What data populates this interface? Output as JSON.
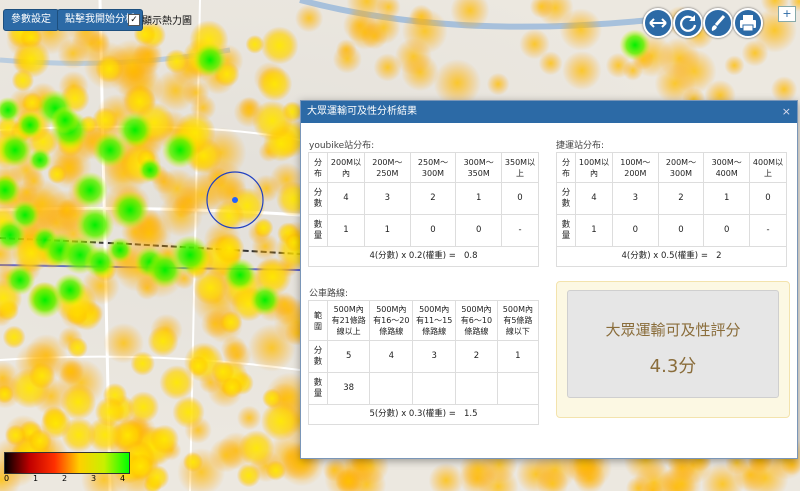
{
  "toolbar": {
    "params_label": "參數設定",
    "start_label": "點擊我開始分析",
    "heatmap_label": "顯示熱力圖",
    "heatmap_checked": "✓"
  },
  "map_controls": {
    "icons": [
      "expand-horizontal-icon",
      "refresh-icon",
      "paintbrush-icon",
      "print-icon"
    ],
    "zoom_in": "+"
  },
  "legend": {
    "labels": [
      "0",
      "1",
      "2",
      "3",
      "4"
    ]
  },
  "dialog": {
    "title": "大眾運輸可及性分析結果",
    "close": "×",
    "youbike": {
      "heading": "youbike站分布:",
      "headers": [
        "分布",
        "200M以內",
        "200M～250M",
        "250M～300M",
        "300M～350M",
        "350M以上"
      ],
      "score_row": [
        "分數",
        "4",
        "3",
        "2",
        "1",
        "0"
      ],
      "count_row": [
        "數量",
        "1",
        "1",
        "0",
        "0",
        "-"
      ],
      "formula": "4(分數) x 0.2(權重) =",
      "result": "0.8"
    },
    "metro": {
      "heading": "捷運站分布:",
      "headers": [
        "分布",
        "100M以內",
        "100M～200M",
        "200M～300M",
        "300M～400M",
        "400M以上"
      ],
      "score_row": [
        "分數",
        "4",
        "3",
        "2",
        "1",
        "0"
      ],
      "count_row": [
        "數量",
        "1",
        "0",
        "0",
        "0",
        "-"
      ],
      "formula": "4(分數) x 0.5(權重) =",
      "result": "2"
    },
    "bus": {
      "heading": "公車路線:",
      "headers": [
        "範圍",
        "500M內有21條路線以上",
        "500M內有16～20條路線",
        "500M內有11～15條路線",
        "500M內有6～10條路線",
        "500M內有5條路線以下"
      ],
      "score_row": [
        "分數",
        "5",
        "4",
        "3",
        "2",
        "1"
      ],
      "count_row": [
        "數量",
        "38",
        "",
        "",
        "",
        ""
      ],
      "formula": "5(分數) x 0.3(權重) =",
      "result": "1.5"
    },
    "score": {
      "title": "大眾運輸可及性評分",
      "value": "4.3分"
    }
  }
}
